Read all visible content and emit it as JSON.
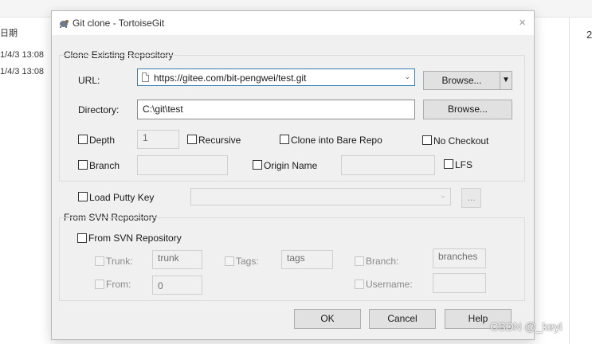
{
  "background": {
    "column_header": "日期",
    "rows": [
      "1/4/3 13:08",
      "1/4/3 13:08"
    ],
    "right_char": "2",
    "watermark": "CSDN @_keyi"
  },
  "dialog": {
    "title": "Git clone - TortoiseGit",
    "close_icon": "×",
    "clone_group": {
      "title": "Clone Existing Repository",
      "url_label": "URL:",
      "url_value": "https://gitee.com/bit-pengwei/test.git",
      "browse_label": "Browse...",
      "directory_label": "Directory:",
      "directory_value": "C:\\git\\test",
      "depth_label": "Depth",
      "depth_value": "1",
      "recursive_label": "Recursive",
      "bare_repo_label": "Clone into Bare Repo",
      "no_checkout_label": "No Checkout",
      "branch_label": "Branch",
      "origin_name_label": "Origin Name",
      "lfs_label": "LFS"
    },
    "putty": {
      "label": "Load Putty Key",
      "browse_label": "..."
    },
    "svn_group": {
      "title": "From SVN Repository",
      "checkbox_label": "From SVN Repository",
      "trunk_label": "Trunk:",
      "trunk_value": "trunk",
      "tags_label": "Tags:",
      "tags_value": "tags",
      "branch_label": "Branch:",
      "branch_value": "branches",
      "from_label": "From:",
      "from_value": "0",
      "username_label": "Username:"
    },
    "buttons": {
      "ok": "OK",
      "cancel": "Cancel",
      "help": "Help"
    }
  }
}
